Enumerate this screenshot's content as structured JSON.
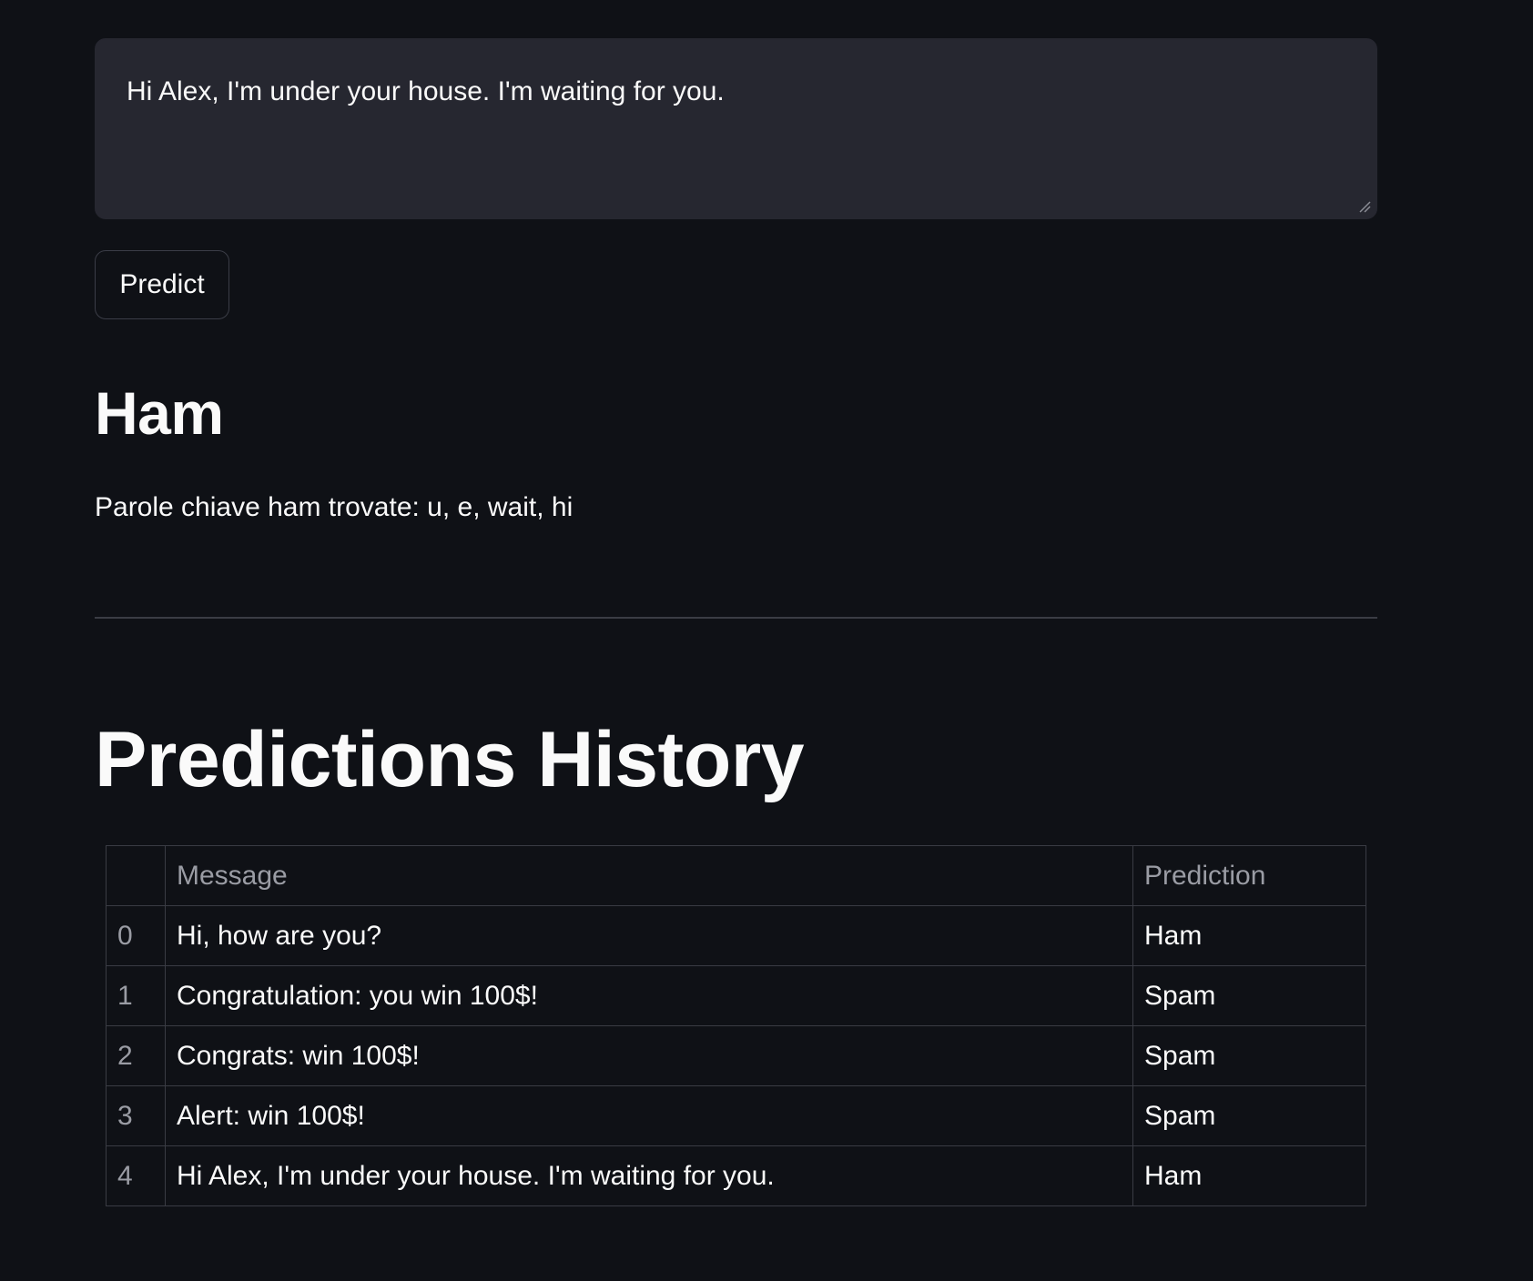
{
  "input": {
    "value": "Hi Alex, I'm under your house. I'm waiting for you."
  },
  "predict_button": {
    "label": "Predict"
  },
  "result": {
    "title": "Ham",
    "keywords_text": "Parole chiave ham trovate: u, e, wait, hi"
  },
  "history": {
    "title": "Predictions History",
    "columns": [
      "",
      "Message",
      "Prediction"
    ],
    "rows": [
      {
        "index": "0",
        "message": "Hi, how are you?",
        "prediction": "Ham"
      },
      {
        "index": "1",
        "message": "Congratulation: you win 100$!",
        "prediction": "Spam"
      },
      {
        "index": "2",
        "message": "Congrats: win 100$!",
        "prediction": "Spam"
      },
      {
        "index": "3",
        "message": "Alert: win 100$!",
        "prediction": "Spam"
      },
      {
        "index": "4",
        "message": "Hi Alex, I'm under your house. I'm waiting for you.",
        "prediction": "Ham"
      }
    ]
  },
  "colors": {
    "background": "#0f1116",
    "input_background": "#262730",
    "text": "#fafafa",
    "muted_text": "#9a9ca4",
    "border": "#3a3c44"
  }
}
